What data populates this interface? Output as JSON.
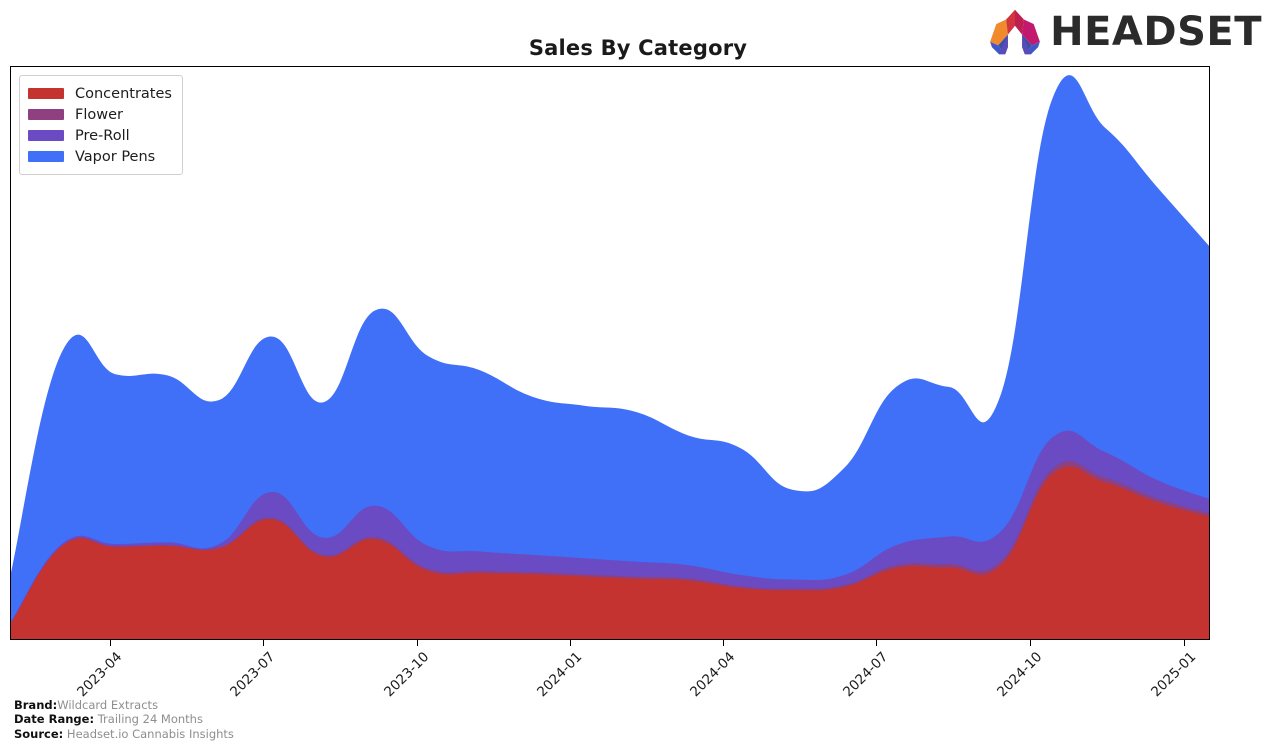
{
  "header": {
    "title": "Sales By Category",
    "logo_text": "HEADSET",
    "logo_colors": {
      "orange": "#F08A2C",
      "red": "#C8203C",
      "magenta": "#C2186E",
      "purple": "#6B3FA0",
      "blue": "#3B5BD6"
    }
  },
  "legend": {
    "position": "top-left",
    "items": [
      {
        "label": "Concentrates",
        "color": "#C4332F"
      },
      {
        "label": "Flower",
        "color": "#8E4080"
      },
      {
        "label": "Pre-Roll",
        "color": "#6A4BC4"
      },
      {
        "label": "Vapor Pens",
        "color": "#4070F8"
      }
    ]
  },
  "footer": {
    "rows": [
      {
        "key": "Brand:",
        "value": "Wildcard Extracts"
      },
      {
        "key": "Date Range:",
        "value": "Trailing 24 Months"
      },
      {
        "key": "Source:",
        "value": "Headset.io Cannabis Insights"
      }
    ]
  },
  "chart_data": {
    "type": "area",
    "stacked": true,
    "title": "Sales By Category",
    "xlabel": "",
    "ylabel": "",
    "grid": false,
    "legend_position": "top-left",
    "axis_tick_labels": [
      "2023-04",
      "2023-07",
      "2023-10",
      "2024-01",
      "2024-04",
      "2024-07",
      "2024-10",
      "2025-01"
    ],
    "axis_tick_fractions": [
      0.083,
      0.211,
      0.339,
      0.467,
      0.594,
      0.722,
      0.85,
      0.978
    ],
    "x": [
      "2023-02",
      "2023-03",
      "2023-04",
      "2023-05",
      "2023-06",
      "2023-07",
      "2023-08",
      "2023-09",
      "2023-10",
      "2023-11",
      "2023-12",
      "2024-01",
      "2024-02",
      "2024-03",
      "2024-04",
      "2024-05",
      "2024-06",
      "2024-07",
      "2024-08",
      "2024-09",
      "2024-10",
      "2024-11",
      "2024-12",
      "2025-01"
    ],
    "ylim": [
      0,
      100
    ],
    "series": [
      {
        "name": "Concentrates",
        "color": "#C4332F",
        "values": [
          3.0,
          16.5,
          16.2,
          16.4,
          16.0,
          21.0,
          14.5,
          17.5,
          12.0,
          11.6,
          11.4,
          11.0,
          10.6,
          10.3,
          9.0,
          8.6,
          9.2,
          12.5,
          12.6,
          13.0,
          29.0,
          27.5,
          24.0,
          21.5
        ]
      },
      {
        "name": "Flower",
        "color": "#8E4080",
        "values": [
          0.05,
          0.1,
          0.1,
          0.1,
          0.1,
          0.3,
          0.3,
          0.4,
          0.4,
          0.4,
          0.4,
          0.4,
          0.4,
          0.4,
          0.3,
          0.3,
          0.3,
          0.5,
          0.6,
          0.7,
          0.9,
          0.8,
          0.7,
          0.6
        ]
      },
      {
        "name": "Pre-Roll",
        "color": "#6A4BC4",
        "values": [
          0.2,
          0.3,
          0.4,
          0.5,
          0.6,
          4.5,
          3.0,
          5.5,
          4.0,
          3.4,
          3.0,
          2.8,
          2.6,
          2.3,
          2.0,
          1.6,
          1.8,
          3.5,
          4.8,
          5.2,
          5.5,
          4.5,
          3.2,
          2.5
        ]
      },
      {
        "name": "Vapor Pens",
        "color": "#4070F8",
        "values": [
          8.0,
          33.5,
          29.5,
          29.0,
          25.0,
          27.0,
          23.5,
          34.0,
          33.0,
          31.5,
          27.5,
          26.5,
          26.0,
          22.5,
          22.0,
          15.5,
          18.5,
          27.5,
          26.0,
          23.5,
          59.0,
          56.5,
          51.0,
          44.0
        ]
      }
    ]
  }
}
